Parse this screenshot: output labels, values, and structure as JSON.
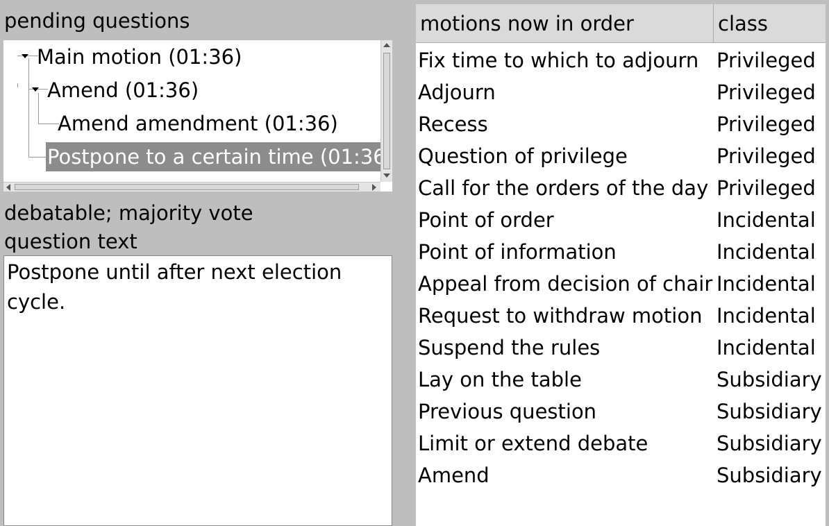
{
  "left": {
    "pending_label": "pending questions",
    "tree": [
      {
        "label": "Main motion (01:36)",
        "selected": false
      },
      {
        "label": "Amend (01:36)",
        "selected": false
      },
      {
        "label": "Amend amendment (01:36)",
        "selected": false
      },
      {
        "label": "Postpone to a certain time (01:36",
        "selected": true
      }
    ],
    "info": "debatable; majority vote",
    "question_label": "question text",
    "question_text": "Postpone until after next election cycle."
  },
  "right": {
    "headers": [
      "motions now in order",
      "class"
    ],
    "rows": [
      {
        "motion": "Fix time to which to adjourn",
        "class": "Privileged"
      },
      {
        "motion": "Adjourn",
        "class": "Privileged"
      },
      {
        "motion": "Recess",
        "class": "Privileged"
      },
      {
        "motion": "Question of privilege",
        "class": "Privileged"
      },
      {
        "motion": "Call for the orders of the day",
        "class": "Privileged"
      },
      {
        "motion": "Point of order",
        "class": "Incidental"
      },
      {
        "motion": "Point of information",
        "class": "Incidental"
      },
      {
        "motion": "Appeal from decision of chair",
        "class": "Incidental"
      },
      {
        "motion": "Request to withdraw motion",
        "class": "Incidental"
      },
      {
        "motion": "Suspend the rules",
        "class": "Incidental"
      },
      {
        "motion": "Lay on the table",
        "class": "Subsidiary"
      },
      {
        "motion": "Previous question",
        "class": "Subsidiary"
      },
      {
        "motion": "Limit or extend debate",
        "class": "Subsidiary"
      },
      {
        "motion": "Amend",
        "class": "Subsidiary"
      }
    ]
  },
  "colors": {
    "window_bg": "#bebebe",
    "selection_bg": "#8c8c8c",
    "header_bg": "#dadada"
  }
}
